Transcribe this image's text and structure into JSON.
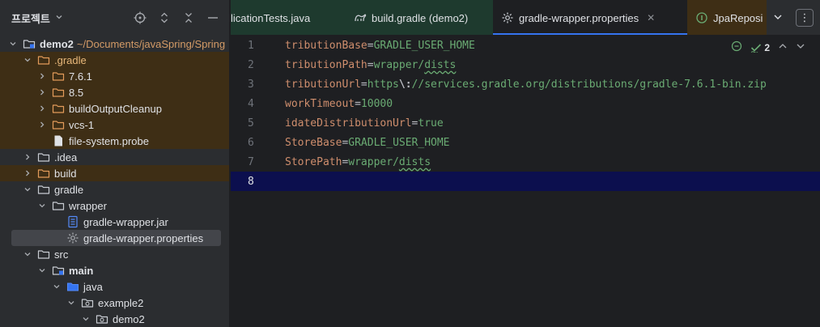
{
  "project_panel": {
    "title": "프로젝트",
    "icons": [
      "target-icon",
      "expand-collapse-icon",
      "collapse-all-icon",
      "minimize-icon"
    ]
  },
  "tree": [
    {
      "label": "demo2",
      "path": "~/Documents/javaSpring/Spring",
      "depth": 0,
      "expanded": true,
      "icon": "module-folder-icon",
      "bold": true
    },
    {
      "label": ".gradle",
      "depth": 1,
      "expanded": true,
      "icon": "excluded-folder-icon",
      "excluded": true,
      "color": "orange"
    },
    {
      "label": "7.6.1",
      "depth": 2,
      "expanded": false,
      "icon": "excluded-folder-icon",
      "excluded": true
    },
    {
      "label": "8.5",
      "depth": 2,
      "expanded": false,
      "icon": "excluded-folder-icon",
      "excluded": true
    },
    {
      "label": "buildOutputCleanup",
      "depth": 2,
      "expanded": false,
      "icon": "excluded-folder-icon",
      "excluded": true
    },
    {
      "label": "vcs-1",
      "depth": 2,
      "expanded": false,
      "icon": "excluded-folder-icon",
      "excluded": true
    },
    {
      "label": "file-system.probe",
      "depth": 2,
      "leaf": true,
      "icon": "file-icon",
      "excluded": true
    },
    {
      "label": ".idea",
      "depth": 1,
      "expanded": false,
      "icon": "folder-icon"
    },
    {
      "label": "build",
      "depth": 1,
      "expanded": false,
      "icon": "excluded-folder-icon",
      "excluded": true
    },
    {
      "label": "gradle",
      "depth": 1,
      "expanded": true,
      "icon": "folder-icon"
    },
    {
      "label": "wrapper",
      "depth": 2,
      "expanded": true,
      "icon": "folder-icon"
    },
    {
      "label": "gradle-wrapper.jar",
      "depth": 3,
      "leaf": true,
      "icon": "jar-icon"
    },
    {
      "label": "gradle-wrapper.properties",
      "depth": 3,
      "leaf": true,
      "icon": "properties-gear-icon",
      "selected": true
    },
    {
      "label": "src",
      "depth": 1,
      "expanded": true,
      "icon": "folder-icon"
    },
    {
      "label": "main",
      "depth": 2,
      "expanded": true,
      "icon": "source-folder-icon",
      "bold": true
    },
    {
      "label": "java",
      "depth": 3,
      "expanded": true,
      "icon": "source-root-icon"
    },
    {
      "label": "example2",
      "depth": 4,
      "expanded": true,
      "icon": "package-icon"
    },
    {
      "label": "demo2",
      "depth": 5,
      "expanded": true,
      "icon": "package-icon"
    }
  ],
  "tabs": [
    {
      "label": "licationTests.java",
      "icon": ""
    },
    {
      "label": "build.gradle (demo2)",
      "icon": "gradle-icon"
    },
    {
      "label": "gradle-wrapper.properties",
      "icon": "properties-gear-icon",
      "active": true,
      "close": "✕"
    },
    {
      "label": "JpaReposi",
      "icon": "interface-icon"
    }
  ],
  "tab_tools": {
    "dropdown": "chevron-down-icon",
    "more": "⋮"
  },
  "inspection": {
    "count": "2"
  },
  "code_lines": [
    {
      "n": "1",
      "key": "tributionBase",
      "value": "GRADLE_USER_HOME"
    },
    {
      "n": "2",
      "key": "tributionPath",
      "value": "wrapper/dists",
      "typo": "dists"
    },
    {
      "n": "3",
      "key": "tributionUrl",
      "value_pre": "https",
      "escape": "\\:",
      "value": "//services.gradle.org/distributions/gradle-7.6.1-bin.zip"
    },
    {
      "n": "4",
      "key": "workTimeout",
      "value": "10000"
    },
    {
      "n": "5",
      "key": "idateDistributionUrl",
      "value": "true"
    },
    {
      "n": "6",
      "key": "StoreBase",
      "value": "GRADLE_USER_HOME"
    },
    {
      "n": "7",
      "key": "StorePath",
      "value": "wrapper/dists",
      "typo": "dists"
    },
    {
      "n": "8",
      "current": true
    }
  ],
  "colors": {
    "excluded_bg": "#3e2e15",
    "current_line": "#0c0f4e",
    "accent": "#3574f0",
    "key": "#cf8e6d",
    "value": "#6aab73"
  }
}
